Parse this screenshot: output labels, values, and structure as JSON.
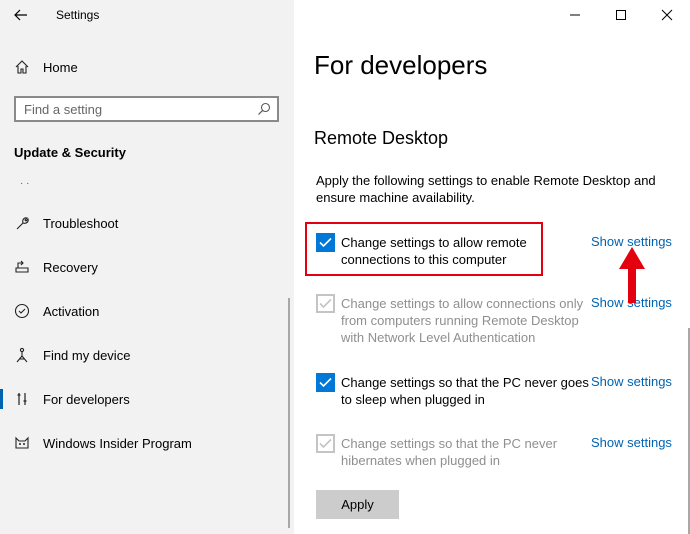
{
  "window": {
    "title": "Settings"
  },
  "sidebar": {
    "home_label": "Home",
    "search_placeholder": "Find a setting",
    "section_title": "Update & Security",
    "dots": "·         ·",
    "items": [
      {
        "label": "Troubleshoot",
        "icon": "wrench-icon"
      },
      {
        "label": "Recovery",
        "icon": "recovery-icon"
      },
      {
        "label": "Activation",
        "icon": "activation-check-icon"
      },
      {
        "label": "Find my device",
        "icon": "find-device-icon"
      },
      {
        "label": "For developers",
        "icon": "developer-tools-icon",
        "active": true
      },
      {
        "label": "Windows Insider Program",
        "icon": "insider-cat-icon"
      }
    ]
  },
  "main": {
    "page_title": "For developers",
    "subheading": "Remote Desktop",
    "description": "Apply the following settings to enable Remote Desktop and ensure machine availability.",
    "options": [
      {
        "label": "Change settings to allow remote connections to this computer",
        "checked": true,
        "disabled": false,
        "link": "Show settings"
      },
      {
        "label": "Change settings to allow connections only from computers running Remote Desktop with Network Level Authentication",
        "checked": true,
        "disabled": true,
        "link": "Show settings"
      },
      {
        "label": "Change settings so that the PC never goes to sleep when plugged in",
        "checked": true,
        "disabled": false,
        "link": "Show settings"
      },
      {
        "label": "Change settings so that the PC never hibernates when plugged in",
        "checked": true,
        "disabled": true,
        "link": "Show settings"
      }
    ],
    "apply_label": "Apply"
  },
  "colors": {
    "accent": "#0078d7",
    "link": "#0063b1",
    "highlight": "#e3000f",
    "sidebar_bg": "#f2f2f2"
  }
}
